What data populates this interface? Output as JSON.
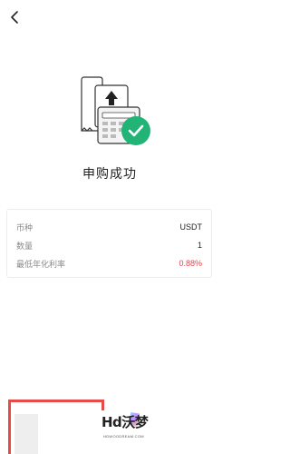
{
  "header": {
    "back_icon": "chevron-left-icon"
  },
  "status": {
    "title": "申购成功",
    "illustration_icon": "receipt-success-icon",
    "accent_color": "#22b377"
  },
  "details": [
    {
      "label": "币种",
      "value": "USDT"
    },
    {
      "label": "数量",
      "value": "1"
    },
    {
      "label": "最低年化利率",
      "value": "0.88%",
      "value_color": "#e8424a"
    }
  ],
  "watermark": {
    "logo": "Hd沃梦",
    "sub": "HDWOODREAM.COM"
  }
}
